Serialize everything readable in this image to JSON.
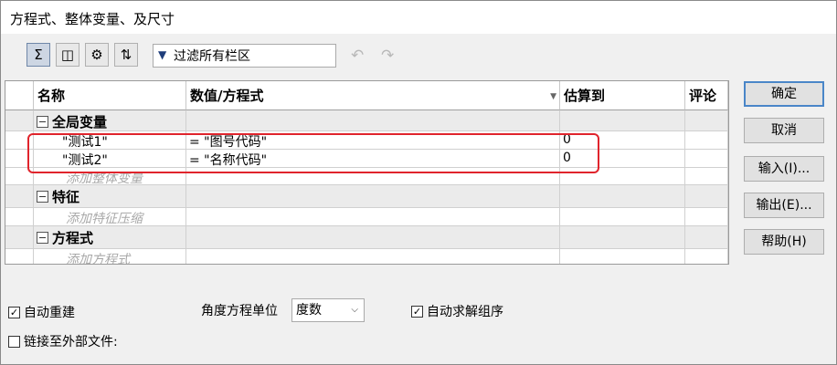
{
  "window": {
    "title": "方程式、整体变量、及尺寸"
  },
  "toolbar": {
    "buttons": [
      {
        "icon": "sigma-icon",
        "glyph": "Σ"
      },
      {
        "icon": "view-dimensions-icon",
        "glyph": "◫"
      },
      {
        "icon": "dependency-view-icon",
        "glyph": "⚙"
      },
      {
        "icon": "sort-order-icon",
        "glyph": "⇅"
      }
    ],
    "filter_text": "过滤所有栏区",
    "undo_glyph": "↶",
    "redo_glyph": "↷"
  },
  "grid": {
    "columns": [
      "名称",
      "数值/方程式",
      "估算到",
      "评论"
    ],
    "groups": [
      {
        "label": "全局变量",
        "rows": [
          {
            "name": "\"测试1\"",
            "value": "= \"图号代码\"",
            "estimate": "0",
            "comment": ""
          },
          {
            "name": "\"测试2\"",
            "value": "= \"名称代码\"",
            "estimate": "0",
            "comment": ""
          }
        ],
        "add_hint": "添加整体变量"
      },
      {
        "label": "特征",
        "rows": [],
        "add_hint": "添加特征压缩"
      },
      {
        "label": "方程式",
        "rows": [],
        "add_hint": "添加方程式"
      }
    ]
  },
  "buttons": {
    "ok": "确定",
    "cancel": "取消",
    "import": "输入(I)...",
    "export": "输出(E)...",
    "help": "帮助(H)"
  },
  "options": {
    "auto_rebuild": {
      "label": "自动重建",
      "checked": true
    },
    "angle_unit_label": "角度方程单位",
    "angle_unit_value": "度数",
    "auto_solve_order": {
      "label": "自动求解组序",
      "checked": true
    },
    "link_external": {
      "label": "链接至外部文件:",
      "checked": false
    }
  },
  "colors": {
    "highlight": "#e0242c",
    "group_bg": "#ebebeb",
    "default_border": "#4a86c8"
  }
}
